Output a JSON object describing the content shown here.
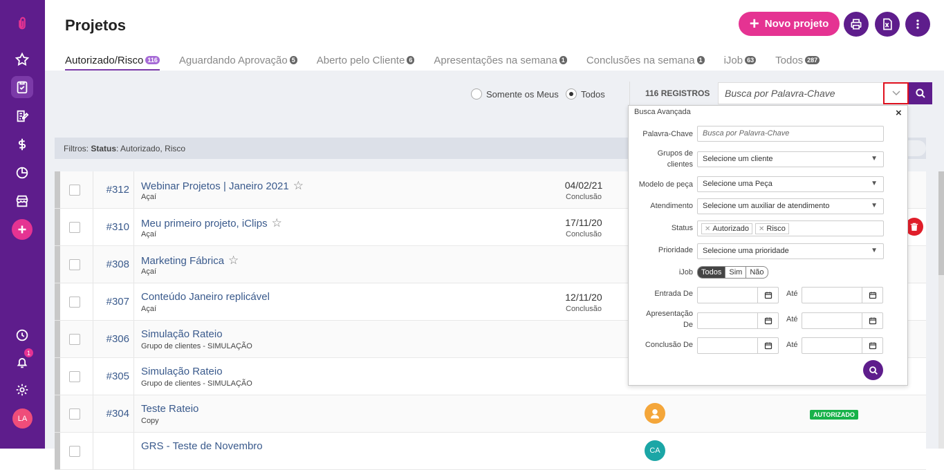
{
  "page": {
    "title": "Projetos"
  },
  "header": {
    "new_button": "Novo projeto"
  },
  "tabs": [
    {
      "label": "Autorizado/Risco",
      "count": "116"
    },
    {
      "label": "Aguardando Aprovação",
      "count": "5"
    },
    {
      "label": "Aberto pelo Cliente",
      "count": "6"
    },
    {
      "label": "Apresentações na semana",
      "count": "1"
    },
    {
      "label": "Conclusões na semana",
      "count": "1"
    },
    {
      "label": "iJob",
      "count": "63"
    },
    {
      "label": "Todos",
      "count": "287"
    }
  ],
  "toolbar": {
    "radio_mine": "Somente os Meus",
    "radio_all": "Todos",
    "records": "116 REGISTROS",
    "search_placeholder": "Busca por Palavra-Chave"
  },
  "filter": {
    "prefix": "Filtros:",
    "label": "Status",
    "value": ": Autorizado, Risco"
  },
  "sidebar": {
    "notification_count": "1",
    "avatar_initials": "LA"
  },
  "rows": [
    {
      "num": "#312",
      "title": "Webinar Projetos | Janeiro 2021",
      "client": "Açaí",
      "date": "04/02/21",
      "date_label": "Conclusão"
    },
    {
      "num": "#310",
      "title": "Meu primeiro projeto, iClips",
      "client": "Açaí",
      "date": "17/11/20",
      "date_label": "Conclusão"
    },
    {
      "num": "#308",
      "title": "Marketing Fábrica",
      "client": "Açaí",
      "date": "",
      "date_label": ""
    },
    {
      "num": "#307",
      "title": "Conteúdo Janeiro replicável",
      "client": "Açaí",
      "date": "12/11/20",
      "date_label": "Conclusão"
    },
    {
      "num": "#306",
      "title": "Simulação Rateio",
      "client": "Grupo de clientes - SIMULAÇÃO",
      "date": "",
      "date_label": ""
    },
    {
      "num": "#305",
      "title": "Simulação Rateio",
      "client": "Grupo de clientes - SIMULAÇÃO",
      "date": "",
      "date_label": ""
    },
    {
      "num": "#304",
      "title": "Teste Rateio",
      "client": "Copy",
      "date": "",
      "date_label": "",
      "status": "AUTORIZADO"
    },
    {
      "num": "",
      "title": "GRS - Teste de Novembro",
      "client": "",
      "date": "",
      "date_label": "",
      "avatar": "CA"
    }
  ],
  "advanced": {
    "title": "Busca Avançada",
    "close": "×",
    "keyword_label": "Palavra-Chave",
    "keyword_placeholder": "Busca por Palavra-Chave",
    "groups_label": "Grupos de clientes",
    "groups_value": "Selecione um cliente",
    "model_label": "Modelo de peça",
    "model_value": "Selecione uma Peça",
    "attendance_label": "Atendimento",
    "attendance_value": "Selecione um auxiliar de atendimento",
    "status_label": "Status",
    "status_tags": [
      "Autorizado",
      "Risco"
    ],
    "priority_label": "Prioridade",
    "priority_value": "Selecione uma prioridade",
    "ijob_label": "iJob",
    "ijob_options": [
      "Todos",
      "Sim",
      "Não"
    ],
    "entry_label": "Entrada De",
    "presentation_label": "Apresentação De",
    "conclusion_label": "Conclusão De",
    "until_label": "Até"
  },
  "colors": {
    "sidebar": "#5e1d8c",
    "accent": "#e53392",
    "status_green": "#18b249"
  }
}
